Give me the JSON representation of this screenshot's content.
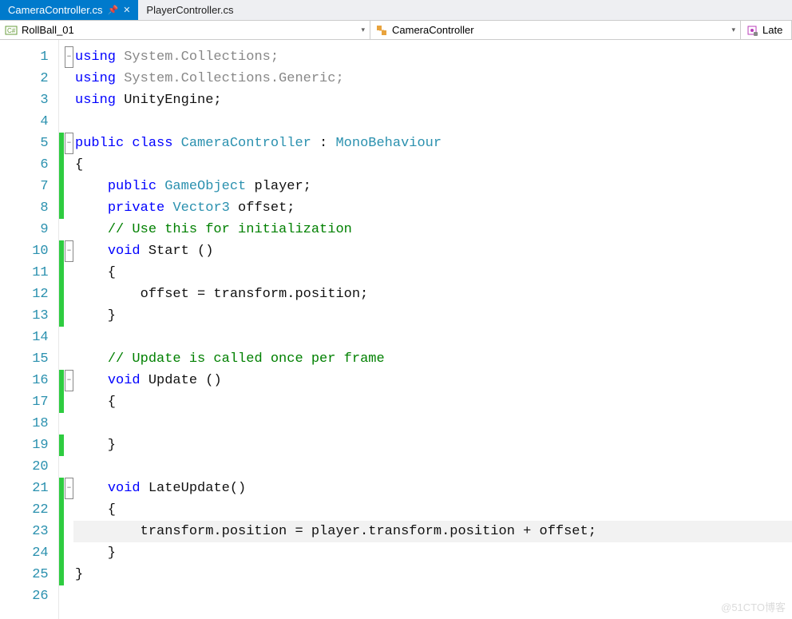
{
  "tabs": [
    {
      "label": "CameraController.cs",
      "active": true,
      "pinned": true,
      "closable": true
    },
    {
      "label": "PlayerController.cs",
      "active": false,
      "pinned": false,
      "closable": false
    }
  ],
  "context": {
    "project": "RollBall_01",
    "class": "CameraController",
    "method": "Late"
  },
  "code": {
    "lines": [
      {
        "num": "1",
        "mod": false,
        "fold": "minus",
        "segs": [
          [
            "kw",
            "using"
          ],
          [
            "dim",
            " System.Collections;"
          ]
        ]
      },
      {
        "num": "2",
        "mod": false,
        "fold": "",
        "segs": [
          [
            "kw",
            "using"
          ],
          [
            "dim",
            " System.Collections.Generic;"
          ]
        ]
      },
      {
        "num": "3",
        "mod": false,
        "fold": "",
        "segs": [
          [
            "kw",
            "using"
          ],
          [
            "",
            " UnityEngine;"
          ]
        ]
      },
      {
        "num": "4",
        "mod": false,
        "fold": "",
        "segs": [
          [
            "",
            ""
          ]
        ]
      },
      {
        "num": "5",
        "mod": true,
        "fold": "minus",
        "segs": [
          [
            "kw",
            "public class "
          ],
          [
            "type",
            "CameraController"
          ],
          [
            "",
            " : "
          ],
          [
            "type",
            "MonoBehaviour"
          ]
        ]
      },
      {
        "num": "6",
        "mod": true,
        "fold": "",
        "segs": [
          [
            "",
            "{"
          ]
        ]
      },
      {
        "num": "7",
        "mod": true,
        "fold": "",
        "segs": [
          [
            "",
            "    "
          ],
          [
            "kw",
            "public "
          ],
          [
            "type",
            "GameObject"
          ],
          [
            "",
            " player;"
          ]
        ]
      },
      {
        "num": "8",
        "mod": true,
        "fold": "",
        "segs": [
          [
            "",
            "    "
          ],
          [
            "kw",
            "private "
          ],
          [
            "type",
            "Vector3"
          ],
          [
            "",
            " offset;"
          ]
        ]
      },
      {
        "num": "9",
        "mod": false,
        "fold": "",
        "segs": [
          [
            "",
            "    "
          ],
          [
            "cm",
            "// Use this for initialization"
          ]
        ]
      },
      {
        "num": "10",
        "mod": true,
        "fold": "minus",
        "segs": [
          [
            "",
            "    "
          ],
          [
            "kw",
            "void"
          ],
          [
            "",
            " Start ()"
          ]
        ]
      },
      {
        "num": "11",
        "mod": true,
        "fold": "",
        "segs": [
          [
            "",
            "    {"
          ]
        ]
      },
      {
        "num": "12",
        "mod": true,
        "fold": "",
        "segs": [
          [
            "",
            "        offset = transform.position;"
          ]
        ]
      },
      {
        "num": "13",
        "mod": true,
        "fold": "",
        "segs": [
          [
            "",
            "    }"
          ]
        ]
      },
      {
        "num": "14",
        "mod": false,
        "fold": "",
        "segs": [
          [
            "",
            ""
          ]
        ]
      },
      {
        "num": "15",
        "mod": false,
        "fold": "",
        "segs": [
          [
            "",
            "    "
          ],
          [
            "cm",
            "// Update is called once per frame"
          ]
        ]
      },
      {
        "num": "16",
        "mod": true,
        "fold": "minus",
        "segs": [
          [
            "",
            "    "
          ],
          [
            "kw",
            "void"
          ],
          [
            "",
            " Update ()"
          ]
        ]
      },
      {
        "num": "17",
        "mod": true,
        "fold": "",
        "segs": [
          [
            "",
            "    {"
          ]
        ]
      },
      {
        "num": "18",
        "mod": false,
        "fold": "",
        "segs": [
          [
            "",
            "        "
          ]
        ]
      },
      {
        "num": "19",
        "mod": true,
        "fold": "",
        "segs": [
          [
            "",
            "    }"
          ]
        ]
      },
      {
        "num": "20",
        "mod": false,
        "fold": "",
        "segs": [
          [
            "",
            ""
          ]
        ]
      },
      {
        "num": "21",
        "mod": true,
        "fold": "minus",
        "segs": [
          [
            "",
            "    "
          ],
          [
            "kw",
            "void"
          ],
          [
            "",
            " LateUpdate()"
          ]
        ]
      },
      {
        "num": "22",
        "mod": true,
        "fold": "",
        "segs": [
          [
            "",
            "    {"
          ]
        ]
      },
      {
        "num": "23",
        "mod": true,
        "fold": "",
        "segs": [
          [
            "",
            "        transform.position = player.transform.position + offset;"
          ]
        ],
        "hl": true
      },
      {
        "num": "24",
        "mod": true,
        "fold": "",
        "segs": [
          [
            "",
            "    }"
          ]
        ]
      },
      {
        "num": "25",
        "mod": true,
        "fold": "",
        "segs": [
          [
            "",
            "}"
          ]
        ]
      },
      {
        "num": "26",
        "mod": false,
        "fold": "",
        "segs": [
          [
            "",
            ""
          ]
        ]
      }
    ]
  },
  "watermark": "@51CTO博客"
}
